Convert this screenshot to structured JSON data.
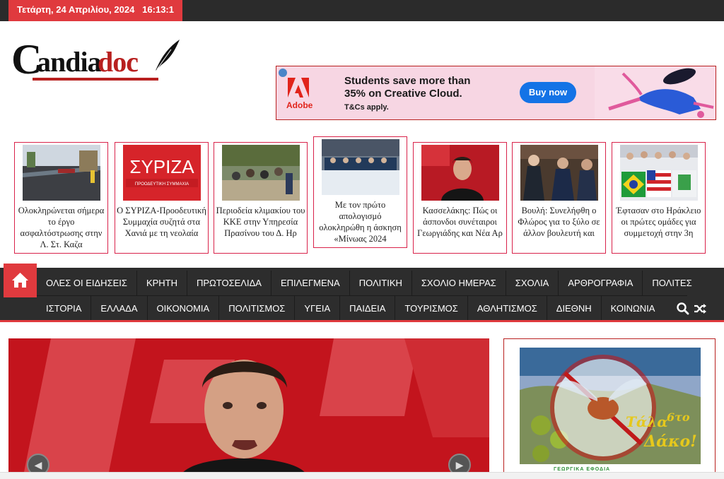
{
  "topbar": {
    "date": "Τετάρτη, 24 Απριλίου, 2024",
    "time": "16:13:1"
  },
  "logo": {
    "c": "C",
    "andia": "andia",
    "doc": "doc"
  },
  "ad": {
    "brand": "Adobe",
    "headline": "Students save more than 35% on Creative Cloud.",
    "terms": "T&Cs apply.",
    "cta": "Buy now"
  },
  "cards": [
    {
      "title": "Ολοκληρώνεται σήμερα το έργο ασφαλτόστρωσης στην Λ. Στ. Καζα"
    },
    {
      "title": "Ο ΣΥΡΙΖΑ-Προοδευτική Συμμαχία συζητά στα Χανιά με τη νεολαία"
    },
    {
      "title": "Περιοδεία κλιμακίου του ΚΚΕ στην Υπηρεσία Πρασίνου του Δ. Ηρ"
    },
    {
      "title": "Με τον πρώτο απολογισμό ολοκληρώθη η άσκηση «Μίνωας 2024"
    },
    {
      "title": "Κασσελάκης: Πώς οι άσπονδοι συνέταιροι Γεωργιάδης και Νέα Αρ"
    },
    {
      "title": "Βουλή: Συνελήφθη ο Φλώρος για το ξύλο σε άλλον βουλευτή και"
    },
    {
      "title": "Έφτασαν στο Ηράκλειο οι πρώτες ομάδες για συμμετοχή στην 3η"
    }
  ],
  "syriza_thumb": {
    "logo": "ΣΥΡΙΖΑ",
    "sub": "ΠΡΟΟΔΕΥΤΙΚΗ ΣΥΜΜΑΧΙΑ"
  },
  "nav": {
    "row1": [
      "ΟΛΕΣ ΟΙ ΕΙΔΗΣΕΙΣ",
      "ΚΡΗΤΗ",
      "ΠΡΩΤΟΣΕΛΙΔΑ",
      "ΕΠΙΛΕΓΜΕΝΑ",
      "ΠΟΛΙΤΙΚΗ",
      "ΣΧΟΛΙΟ ΗΜΕΡΑΣ",
      "ΣΧΟΛΙΑ",
      "ΑΡΘΡΟΓΡΑΦΙΑ",
      "ΠΟΛΙΤΕΣ"
    ],
    "row2": [
      "ΙΣΤΟΡΙΑ",
      "ΕΛΛΑΔΑ",
      "ΟΙΚΟΝΟΜΙΑ",
      "ΠΟΛΙΤΙΣΜΟΣ",
      "ΥΓΕΙΑ",
      "ΠΑΙΔΕΙΑ",
      "ΤΟΥΡΙΣΜΟΣ",
      "ΑΘΛΗΤΙΣΜΟΣ",
      "ΔΙΕΘΝΗ",
      "ΚΟΙΝΩΝΙΑ"
    ]
  },
  "sidebar_ad": {
    "text1": "Τάλα",
    "text2": "6το",
    "text3": "Δάκο!",
    "footer": "ΓΕΩΡΓΙΚΑ ΕΦΟΔΙΑ"
  },
  "colors": {
    "accent": "#e03a3e",
    "nav_bg": "#2d2d2d",
    "brand_red": "#b8201f"
  }
}
